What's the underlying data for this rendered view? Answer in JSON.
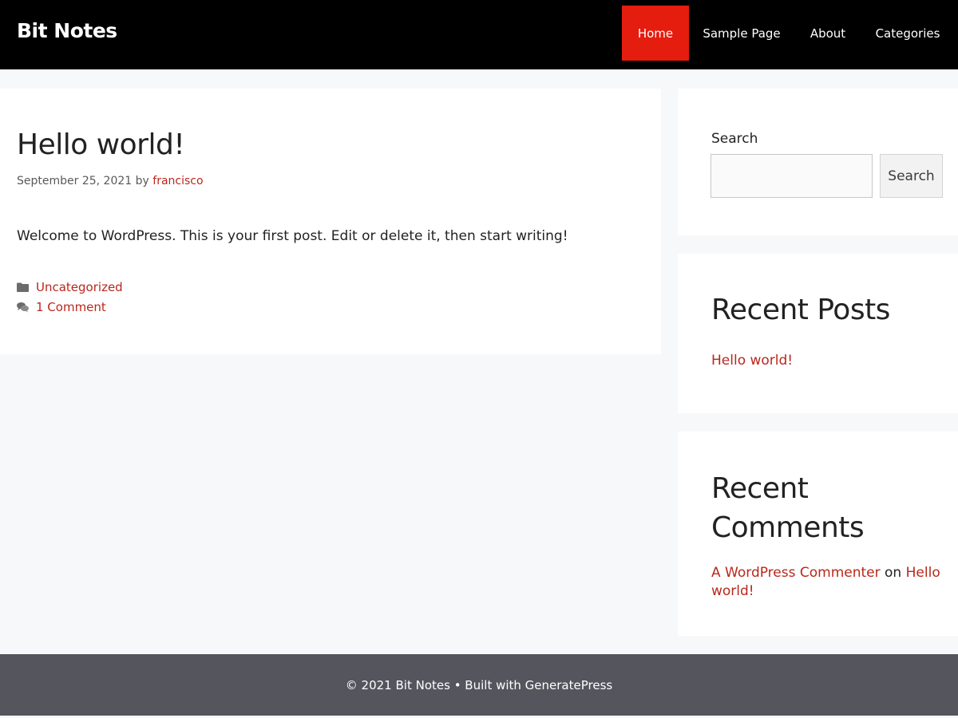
{
  "header": {
    "site_title": "Bit Notes",
    "nav": [
      {
        "label": "Home",
        "active": true
      },
      {
        "label": "Sample Page",
        "active": false
      },
      {
        "label": "About",
        "active": false
      },
      {
        "label": "Categories",
        "active": false
      }
    ]
  },
  "post": {
    "title": "Hello world!",
    "date": "September 25, 2021",
    "by": "by",
    "author": "francisco",
    "body": "Welcome to WordPress. This is your first post. Edit or delete it, then start writing!",
    "category": "Uncategorized",
    "comments": "1 Comment",
    "category_icon": "folder-icon",
    "comments_icon": "comments-icon"
  },
  "sidebar": {
    "search": {
      "label": "Search",
      "input_value": "",
      "button_label": "Search"
    },
    "recent_posts": {
      "title": "Recent Posts",
      "items": [
        "Hello world!"
      ]
    },
    "recent_comments": {
      "title": "Recent Comments",
      "author": "A WordPress Commenter",
      "on": "on",
      "post": "Hello world!"
    }
  },
  "footer": {
    "text": "© 2021 Bit Notes • Built with GeneratePress"
  },
  "colors": {
    "header_bg": "#000000",
    "nav_active": "#e51d0f",
    "link": "#b9271b",
    "footer_bg": "#55555e",
    "page_bg": "#f7f8f9"
  }
}
